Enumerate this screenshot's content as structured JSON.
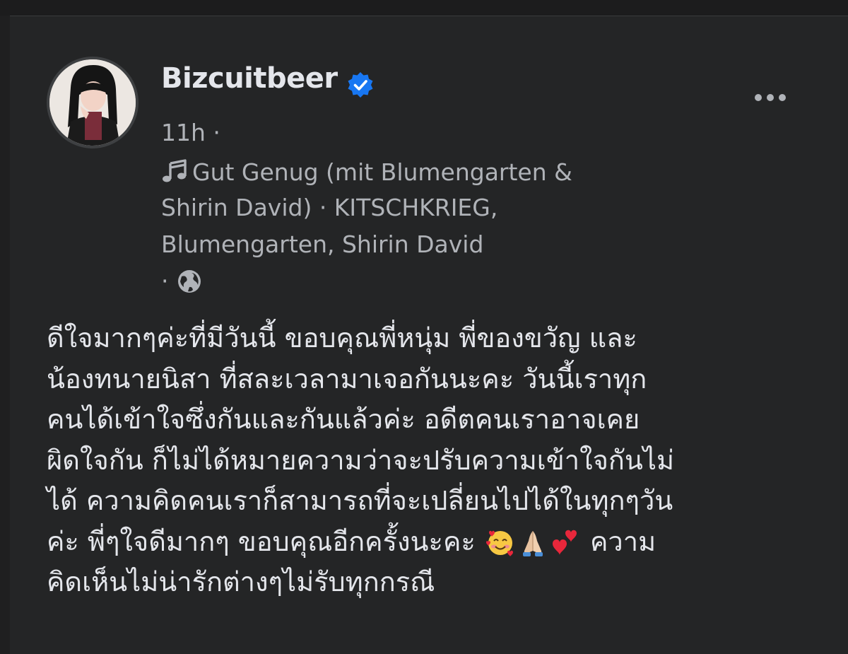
{
  "post": {
    "author": "Bizcuitbeer",
    "verified": true,
    "time": "11h ·",
    "music_lines": [
      "Gut Genug (mit Blumengarten &",
      "Shirin David) · KITSCHKRIEG,",
      "Blumengarten, Shirin David"
    ],
    "music_icon": "music-note-icon",
    "privacy_prefix": "·",
    "privacy_icon": "globe-icon",
    "text_lines": [
      "ดีใจมากๆค่ะที่มีวันนี้ ขอบคุณพี่หนุ่ม พี่ของขวัญ และ",
      "น้องทนายนิสา ที่สละเวลามาเจอกันนะคะ วันนี้เราทุก",
      "คนได้เข้าใจซึ่งกันและกันแล้วค่ะ อดีตคนเราอาจเคย",
      "ผิดใจกัน ก็ไม่ได้หมายความว่าจะปรับความเข้าใจกันไม่",
      "ได้ ความคิดคนเราก็สามารถที่จะเปลี่ยนไปได้ในทุกๆวัน",
      "ค่ะ พี่ๆใจดีมากๆ ขอบคุณอีกครั้งนะคะ",
      "ความ",
      "คิดเห็นไม่น่ารักต่างๆไม่รับทุกกรณี"
    ],
    "emojis": [
      "smiling-face-with-hearts",
      "folded-hands",
      "two-hearts"
    ]
  },
  "colors": {
    "background": "#242526",
    "text_primary": "#e4e6eb",
    "text_secondary": "#b0b3b8",
    "verified_blue": "#1877f2"
  }
}
